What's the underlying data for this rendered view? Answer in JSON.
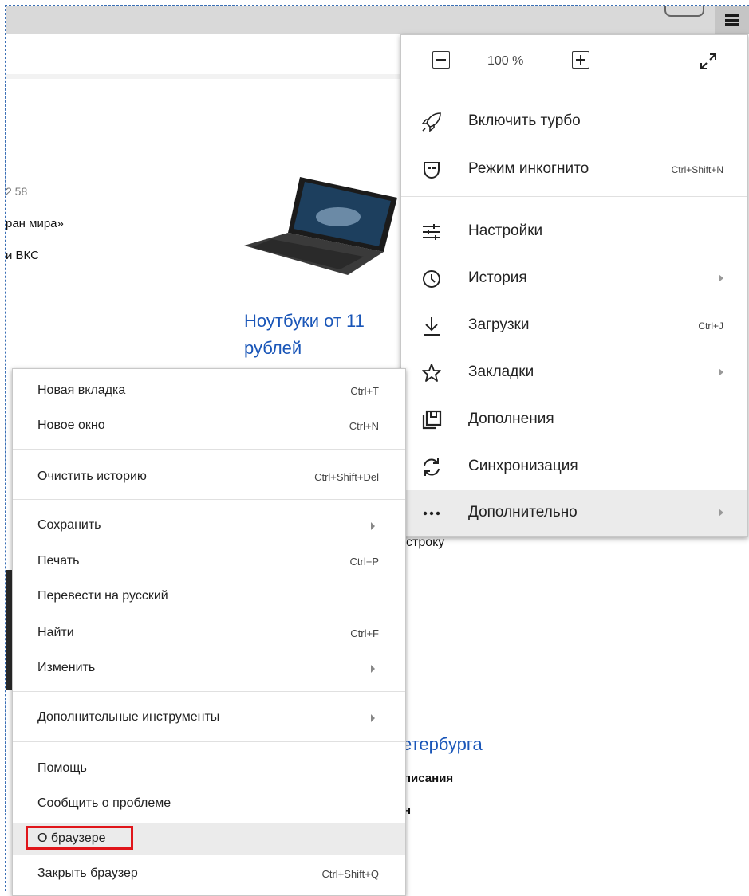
{
  "zoom": {
    "value": "100 %",
    "minus": "−",
    "plus": "+"
  },
  "main_menu": {
    "items": [
      {
        "label": "Включить турбо",
        "shortcut": "",
        "icon": "rocket-icon"
      },
      {
        "label": "Режим инкогнито",
        "shortcut": "Ctrl+Shift+N",
        "icon": "incognito-mask-icon"
      },
      {
        "label": "Настройки",
        "shortcut": "",
        "icon": "settings-sliders-icon"
      },
      {
        "label": "История",
        "shortcut": "",
        "icon": "clock-icon",
        "submenu": true
      },
      {
        "label": "Загрузки",
        "shortcut": "Ctrl+J",
        "icon": "download-icon"
      },
      {
        "label": "Закладки",
        "shortcut": "",
        "icon": "star-icon",
        "submenu": true
      },
      {
        "label": "Дополнения",
        "shortcut": "",
        "icon": "extensions-icon"
      },
      {
        "label": "Синхронизация",
        "shortcut": "",
        "icon": "sync-icon"
      },
      {
        "label": "Дополнительно",
        "shortcut": "",
        "icon": "more-dots-icon",
        "submenu": true,
        "active": true
      }
    ]
  },
  "sub_menu": {
    "items": [
      {
        "label": "Новая вкладка",
        "shortcut": "Ctrl+T"
      },
      {
        "label": "Новое окно",
        "shortcut": "Ctrl+N"
      },
      {
        "label": "Очистить историю",
        "shortcut": "Ctrl+Shift+Del"
      },
      {
        "label": "Сохранить",
        "shortcut": ""
      },
      {
        "label": "Печать",
        "shortcut": "Ctrl+P"
      },
      {
        "label": "Перевести на русский",
        "shortcut": ""
      },
      {
        "label": "Найти",
        "shortcut": "Ctrl+F"
      },
      {
        "label": "Изменить",
        "shortcut": ""
      },
      {
        "label": "Дополнительные инструменты",
        "shortcut": ""
      },
      {
        "label": "Помощь",
        "shortcut": ""
      },
      {
        "label": "Сообщить о проблеме",
        "shortcut": ""
      },
      {
        "label": "О браузере",
        "shortcut": ""
      },
      {
        "label": "Закрыть браузер",
        "shortcut": "Ctrl+Shift+Q"
      }
    ]
  },
  "page": {
    "num_fragment": "2 58",
    "text1": "ран мира»",
    "text2": "и ВКС",
    "ad_title_1": "Ноутбуки от 11",
    "ad_title_2": "рублей",
    "fragment_stroku": "строку",
    "fragment_peterburg": "етербурга",
    "fragment_pisaniya": "писания",
    "fragment_n": "н"
  },
  "colors": {
    "accent_link": "#1a56b8",
    "highlight_border": "#e0161b",
    "menu_active": "#ebebeb"
  }
}
